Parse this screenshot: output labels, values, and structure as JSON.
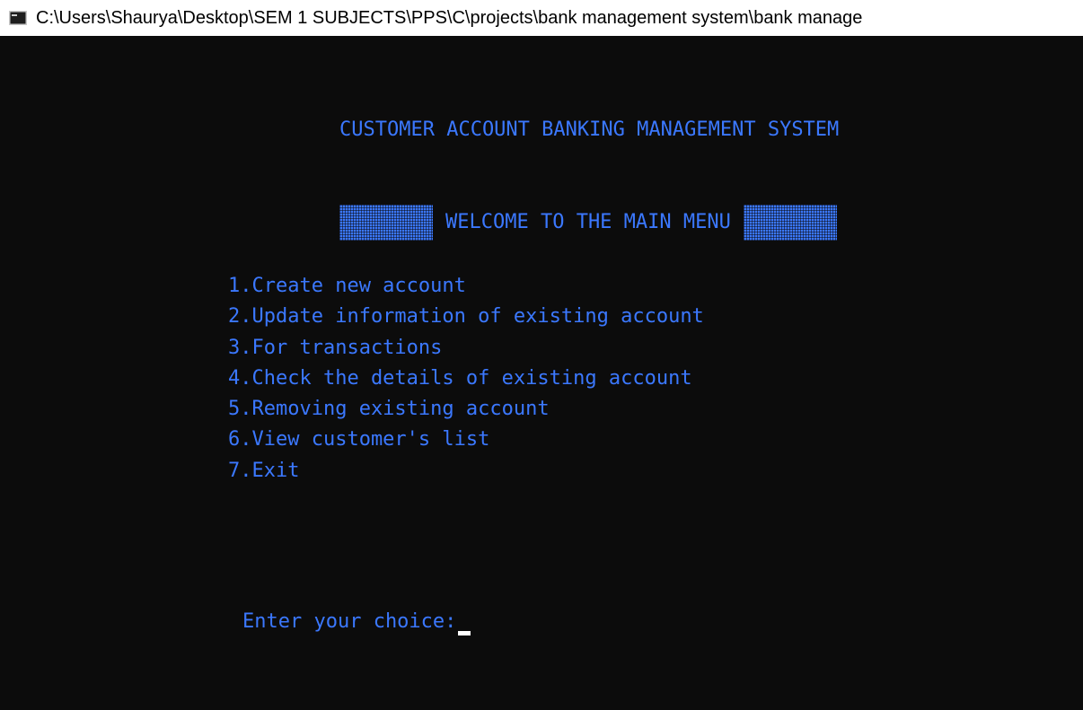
{
  "window": {
    "title": "C:\\Users\\Shaurya\\Desktop\\SEM 1 SUBJECTS\\PPS\\C\\projects\\bank management system\\bank manage"
  },
  "console": {
    "heading": "CUSTOMER ACCOUNT BANKING MANAGEMENT SYSTEM",
    "welcome": "WELCOME TO THE MAIN MENU",
    "menu": [
      "1.Create new account",
      "2.Update information of existing account",
      "3.For transactions",
      "4.Check the details of existing account",
      "5.Removing existing account",
      "6.View customer's list",
      "7.Exit"
    ],
    "prompt": "Enter your choice:"
  },
  "colors": {
    "background": "#0c0c0c",
    "text": "#3b78ff",
    "titlebar": "#ffffff",
    "cursor": "#ffffff"
  },
  "icons": {
    "title": "console-window-icon"
  }
}
